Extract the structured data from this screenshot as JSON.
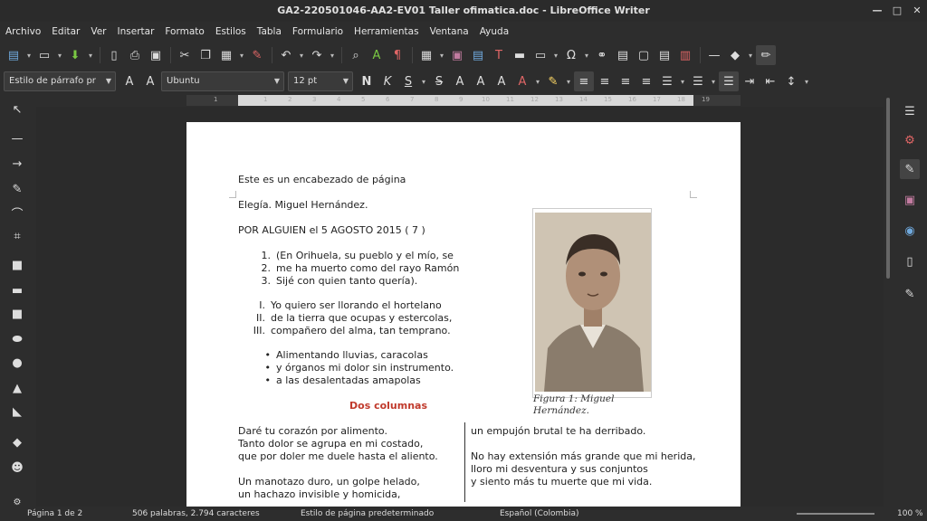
{
  "window": {
    "title": "GA2-220501046-AA2-EV01 Taller ofimatica.doc - LibreOffice Writer",
    "controls": [
      "—",
      "□",
      "✕"
    ]
  },
  "menu": [
    "Archivo",
    "Editar",
    "Ver",
    "Insertar",
    "Formato",
    "Estilos",
    "Tabla",
    "Formulario",
    "Herramientas",
    "Ventana",
    "Ayuda"
  ],
  "formatting": {
    "paragraph_style": "Estilo de párrafo pr",
    "font_name": "Ubuntu",
    "font_size": "12 pt"
  },
  "ruler": {
    "ticks": [
      "1",
      "1",
      "2",
      "3",
      "4",
      "5",
      "6",
      "7",
      "8",
      "9",
      "10",
      "11",
      "12",
      "13",
      "14",
      "15",
      "16",
      "17",
      "18",
      "19"
    ]
  },
  "document": {
    "header": "Este es un encabezado de página",
    "title_line": "Elegía. Miguel Hernández.",
    "dedication": "POR ALGUIEN el 5 AGOSTO 2015 ( 7 )",
    "numbered": [
      {
        "marker": "1.",
        "text": "(En Orihuela, su pueblo y el mío, se"
      },
      {
        "marker": "2.",
        "text": "me ha muerto como del rayo Ramón"
      },
      {
        "marker": "3.",
        "text": "Sijé con quien tanto quería)."
      }
    ],
    "roman": [
      {
        "marker": "I.",
        "text": "Yo quiero ser llorando el hortelano"
      },
      {
        "marker": "II.",
        "text": "de la tierra que ocupas y estercolas,"
      },
      {
        "marker": "III.",
        "text": "compañero del alma, tan temprano."
      }
    ],
    "bullets": [
      {
        "marker": "•",
        "text": "Alimentando lluvias, caracolas"
      },
      {
        "marker": "•",
        "text": "y órganos mi dolor sin instrumento."
      },
      {
        "marker": "•",
        "text": "a las desalentadas amapolas"
      }
    ],
    "section_heading": "Dos columnas",
    "col_left": [
      "Daré tu corazón por alimento.",
      "Tanto dolor se agrupa en mi costado,",
      "que por doler me duele hasta el aliento.",
      "",
      "Un manotazo duro, un golpe helado,",
      "un hachazo invisible y homicida,"
    ],
    "col_right": [
      "un empujón brutal te ha derribado.",
      "",
      "No hay extensión más grande que mi herida,",
      "lloro mi desventura y sus conjuntos",
      "y siento más tu muerte que mi vida."
    ],
    "figure_caption_1": "Figura 1: Miguel",
    "figure_caption_2": "Hernández."
  },
  "status": {
    "page": "Página 1 de 2",
    "words": "506 palabras, 2.794 caracteres",
    "page_style": "Estilo de página predeterminado",
    "language": "Español (Colombia)",
    "zoom": "100 %"
  }
}
